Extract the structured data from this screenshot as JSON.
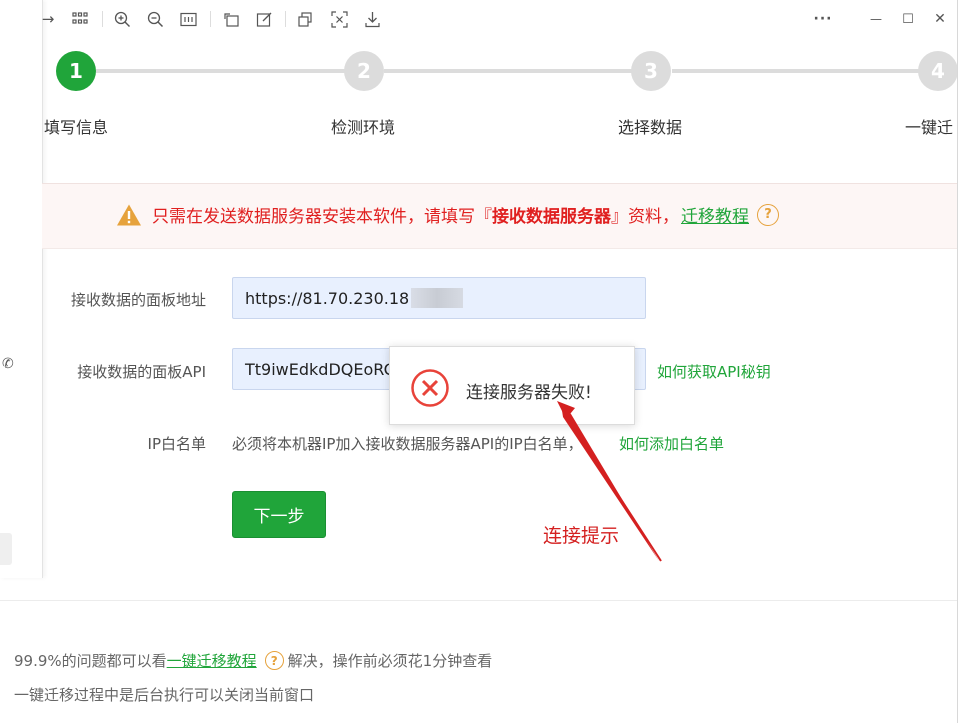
{
  "toolbar": {
    "items": [
      "arrow-right-icon",
      "grid-icon",
      "zoom-in-icon",
      "zoom-out-icon",
      "fit-icon",
      "rotate-icon",
      "edit-icon",
      "copy-icon",
      "screenshot-icon",
      "download-icon"
    ],
    "more": "···",
    "minimize": "—",
    "maximize": "☐",
    "close": "✕"
  },
  "steps": [
    {
      "num": "1",
      "label": "填写信息",
      "active": true
    },
    {
      "num": "2",
      "label": "检测环境",
      "active": false
    },
    {
      "num": "3",
      "label": "选择数据",
      "active": false
    },
    {
      "num": "4",
      "label": "一键迁",
      "active": false
    }
  ],
  "notice": {
    "text": "只需在发送数据服务器安装本软件，请填写『",
    "strong": " 接收数据服务器 ",
    "tail": "』资料，",
    "link": "迁移教程",
    "help": "?"
  },
  "form": {
    "address_label": "接收数据的面板地址",
    "address_value": "https://81.70.230.18",
    "api_label": "接收数据的面板API",
    "api_value": "Tt9iwEdkdDQEoRC",
    "api_link": "如何获取API秘钥",
    "ip_label": "IP白名单",
    "ip_text": "必须将本机器IP加入接收数据服务器API的IP白名单，",
    "ip_link": "如何添加白名单",
    "next_button": "下一步"
  },
  "popup": {
    "message": "连接服务器失败!"
  },
  "annotation": {
    "text": "连接提示"
  },
  "footer": {
    "line1_prefix": "99.9%的问题都可以看",
    "line1_link": "一键迁移教程",
    "line1_help": "?",
    "line1_suffix": "解决，操作前必须花1分钟查看",
    "line2": "一键迁移过程中是后台执行可以关闭当前窗口"
  },
  "colors": {
    "accent_green": "#20a53a",
    "warning_red": "#e02020",
    "warning_orange": "#e6a23c",
    "annotation_red": "#d42020"
  }
}
